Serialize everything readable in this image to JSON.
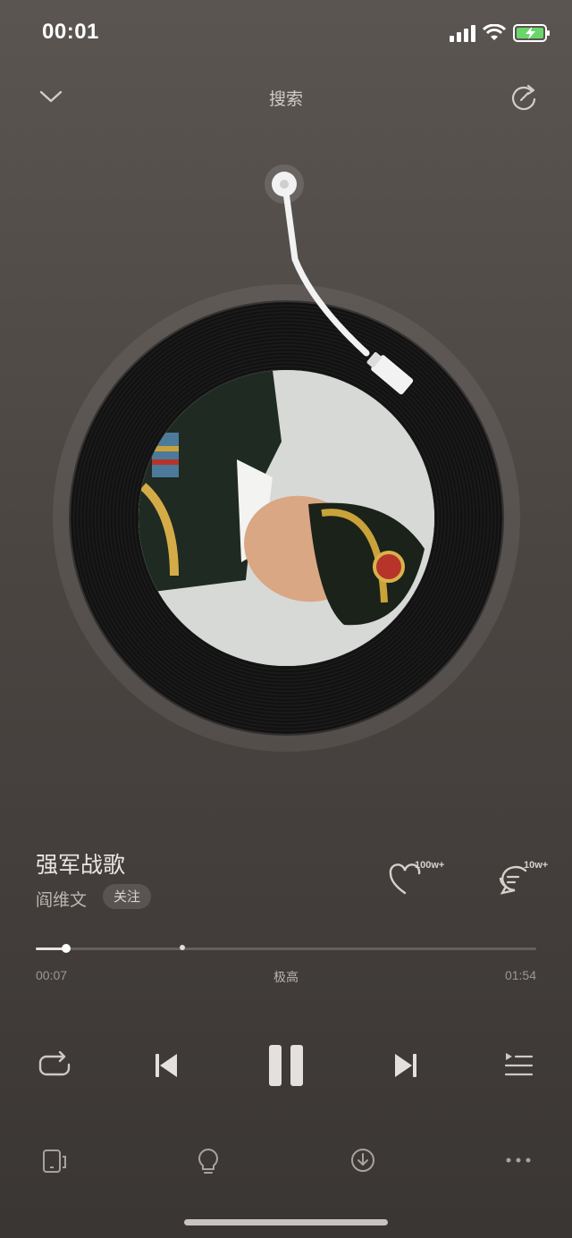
{
  "status_bar": {
    "time": "00:01"
  },
  "header": {
    "title": "搜索",
    "collapse_icon": "chevron-down-icon",
    "share_icon": "share-refresh-icon"
  },
  "song": {
    "title": "强军战歌",
    "artist": "阎维文",
    "follow_label": "关注",
    "likes_badge": "100w+",
    "comments_badge": "10w+"
  },
  "progress": {
    "current": "00:07",
    "duration": "01:54",
    "quality": "极高",
    "played_fraction": 0.061,
    "buffer_marker_fraction": 0.293
  },
  "controls": {
    "repeat_icon": "repeat-icon",
    "prev_icon": "skip-previous-icon",
    "play_pause_icon": "pause-icon",
    "next_icon": "skip-next-icon",
    "playlist_icon": "playlist-icon"
  },
  "bottom_actions": [
    "device-icon",
    "lightbulb-icon",
    "download-icon",
    "more-icon"
  ],
  "colors": {
    "background_top": "#5b5552",
    "background_bottom": "#3a3634",
    "accent": "#e6e2df"
  }
}
